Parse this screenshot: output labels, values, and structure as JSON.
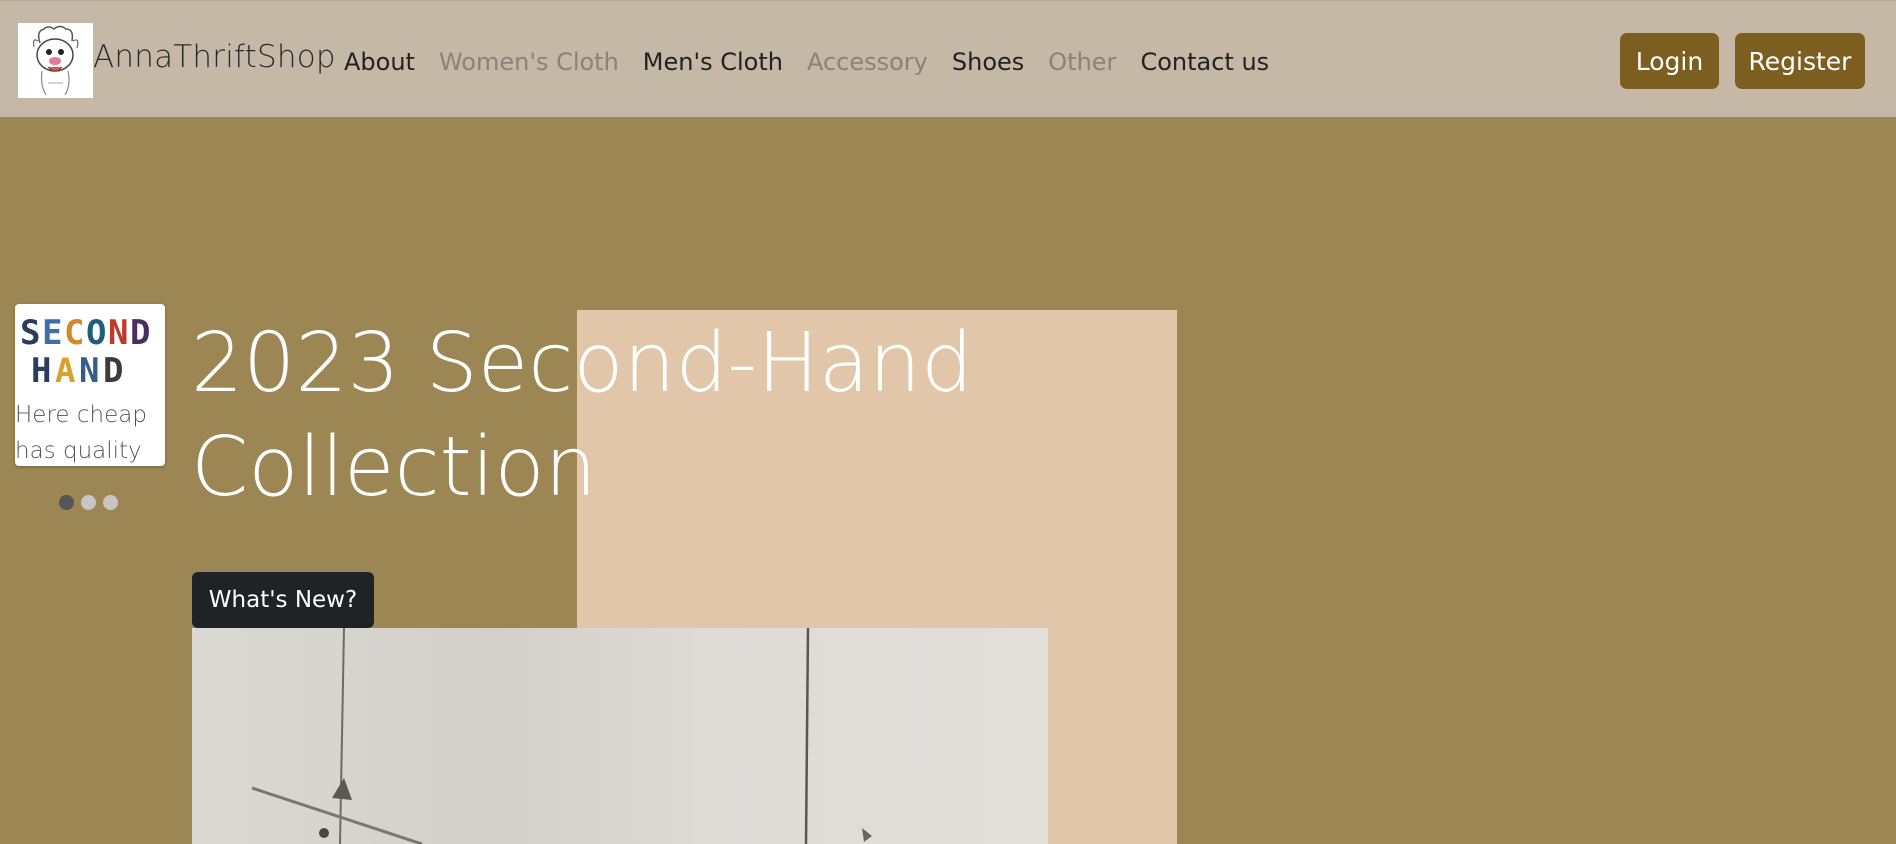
{
  "brand": {
    "name": "AnnaThriftShop",
    "logo_icon": "cartoon-monkey-logo-icon"
  },
  "nav": {
    "items": [
      {
        "label": "About",
        "state": "active"
      },
      {
        "label": "Women's Cloth",
        "state": "muted"
      },
      {
        "label": "Men's Cloth",
        "state": "active"
      },
      {
        "label": "Accessory",
        "state": "muted"
      },
      {
        "label": "Shoes",
        "state": "active"
      },
      {
        "label": "Other",
        "state": "muted"
      },
      {
        "label": "Contact us",
        "state": "active"
      }
    ],
    "login_label": "Login",
    "register_label": "Register"
  },
  "carousel": {
    "card_logo_text": [
      "SECOND",
      "HAND"
    ],
    "card_caption": "Here cheap has quality",
    "slide_count": 3,
    "active_slide": 1
  },
  "hero": {
    "title": "2023 Second-Hand Collection",
    "cta_label": "What's New?"
  },
  "colors": {
    "navbar_bg": "#c6b8a6",
    "page_bg": "#9c8653",
    "accent_panel": "#e1c6aa",
    "brown_button": "#7d5e21",
    "dark_button": "#1f2326"
  }
}
